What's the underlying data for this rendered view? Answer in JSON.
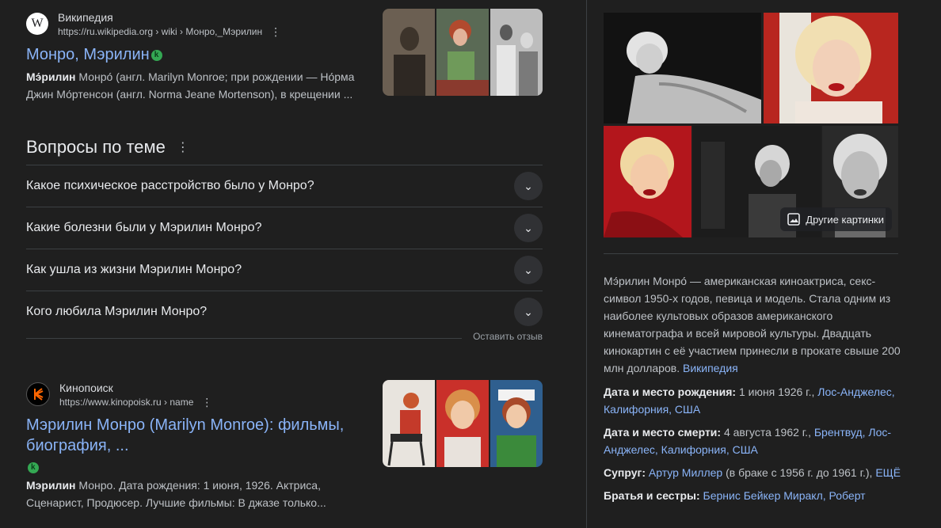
{
  "results": [
    {
      "site_name": "Википедия",
      "url": "https://ru.wikipedia.org › wiki › Монро,_Мэрилин",
      "title": "Монро, Мэрилин",
      "snippet_bold": "Мэ́рилин",
      "snippet_rest": " Монро́ (англ. Marilyn Monroe; при рождении — Но́рма Джин Мо́ртенсон (англ. Norma Jeane Mortenson), в крещении ...",
      "favicon_letter": "W"
    },
    {
      "site_name": "Кинопоиск",
      "url": "https://www.kinopoisk.ru › name",
      "title": "Мэрилин Монро (Marilyn Monroe): фильмы, биография, ...",
      "snippet_bold": "Мэрилин",
      "snippet_rest": " Монро. Дата рождения: 1 июня, 1926. Актриса, Сценарист, Продюсер. Лучшие фильмы: В джазе только..."
    }
  ],
  "paa": {
    "title": "Вопросы по теме",
    "questions": [
      "Какое психическое расстройство было у Монро?",
      "Какие болезни были у Мэрилин Монро?",
      "Как ушла из жизни Мэрилин Монро?",
      "Кого любила Мэрилин Монро?"
    ],
    "feedback": "Оставить отзыв"
  },
  "knowledge_panel": {
    "more_images": "Другие картинки",
    "description": "Мэ́рилин Монро́ — американская киноактриса, секс-символ 1950-х годов, певица и модель. Стала одним из наиболее культовых образов американского кинематографа и всей мировой культуры. Двадцать кинокартин с её участием принесли в прокате свыше 200 млн долларов.",
    "source": "Википедия",
    "birth_label": "Дата и место рождения:",
    "birth_value": "1 июня 1926 г.,",
    "birth_link": "Лос-Анджелес, Калифорния, США",
    "death_label": "Дата и место смерти:",
    "death_value": "4 августа 1962 г.,",
    "death_link": "Брентвуд, Лос-Анджелес, Калифорния, США",
    "spouse_label": "Супруг:",
    "spouse_link": "Артур Миллер",
    "spouse_value": " (в браке с 1956 г. до 1961 г.),",
    "spouse_more": "ЕЩЁ",
    "siblings_label": "Братья и сестры:",
    "siblings_link": "Бернис Бейкер Миракл, Роберт"
  },
  "colors": {
    "background": "#1f1f1f",
    "link": "#8ab4f8",
    "verified": "#34a853"
  }
}
